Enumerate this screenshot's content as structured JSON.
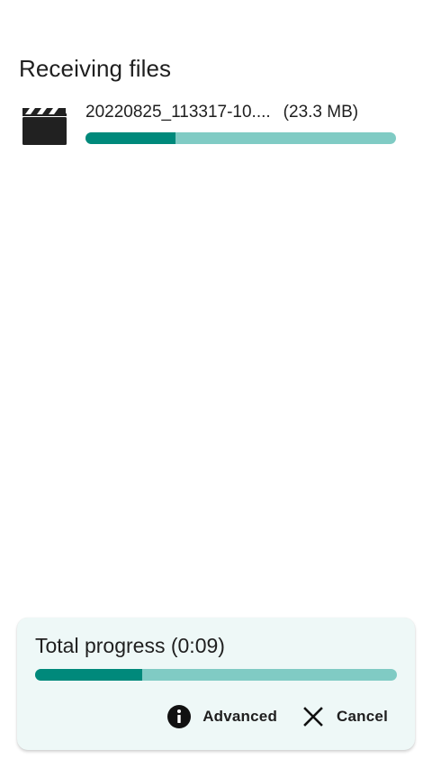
{
  "page": {
    "title": "Receiving files"
  },
  "files": [
    {
      "icon": "movie-clapperboard-icon",
      "name": "20220825_113317-10....",
      "size": "(23.3 MB)",
      "progress_fraction": 0.29
    }
  ],
  "total": {
    "label": "Total progress (0:09)",
    "progress_fraction": 0.295
  },
  "actions": {
    "advanced_label": "Advanced",
    "advanced_icon": "info-icon",
    "cancel_label": "Cancel",
    "cancel_icon": "close-icon"
  },
  "colors": {
    "progress_fill": "#00897b",
    "progress_track": "#80cbc4",
    "card_background": "#eef8f7"
  }
}
